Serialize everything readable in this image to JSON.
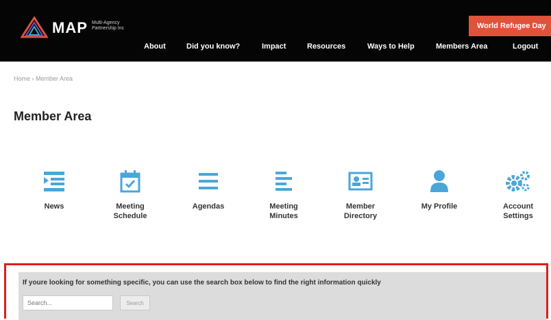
{
  "header": {
    "logo_text": "MAP",
    "logo_sub": "Multi-Agency Partnership Inc",
    "cta_label": "World Refugee Day",
    "nav": [
      "About",
      "Did you know?",
      "Impact",
      "Resources",
      "Ways to Help",
      "Members Area",
      "Logout"
    ]
  },
  "breadcrumb": "Home › Member Area",
  "page_title": "Member Area",
  "tiles": [
    {
      "label": "News",
      "icon": "news-icon"
    },
    {
      "label": "Meeting\nSchedule",
      "icon": "calendar-check-icon"
    },
    {
      "label": "Agendas",
      "icon": "list-icon"
    },
    {
      "label": "Meeting\nMinutes",
      "icon": "align-left-icon"
    },
    {
      "label": "Member\nDirectory",
      "icon": "id-card-icon"
    },
    {
      "label": "My Profile",
      "icon": "user-icon"
    },
    {
      "label": "Account\nSettings",
      "icon": "gears-icon"
    }
  ],
  "search": {
    "message": "If youre looking for something specific, you can use the search box below to find the right information quickly",
    "placeholder": "Search...",
    "button_label": "Search"
  },
  "colors": {
    "header_bg": "#050505",
    "accent": "#e0523a",
    "icon_blue": "#4aa6d9",
    "highlight_border": "#e01b1b"
  }
}
